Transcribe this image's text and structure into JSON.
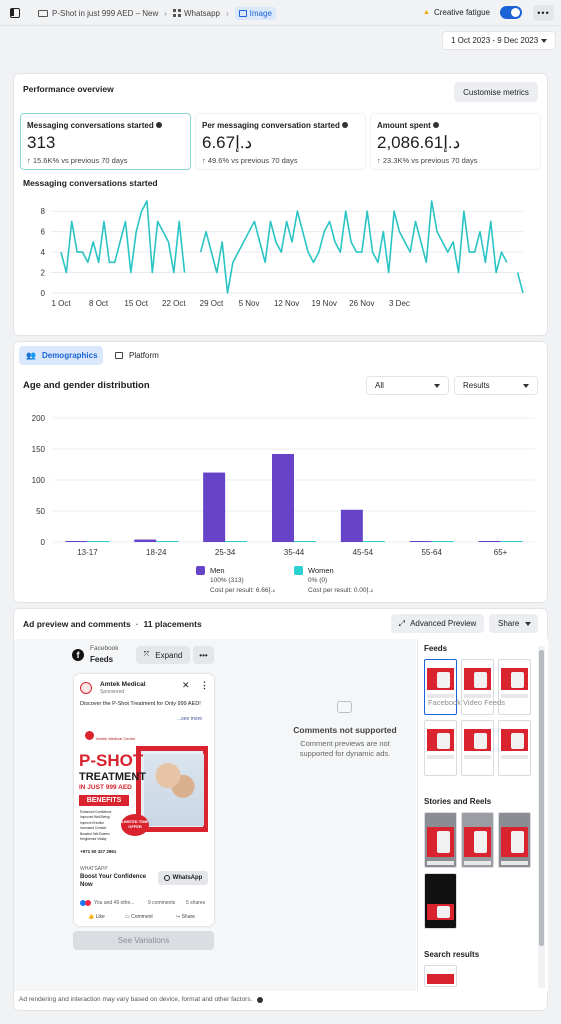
{
  "topbar": {
    "breadcrumbs": [
      "P-Shot in just 999 AED – New",
      "Whatsapp",
      "Image"
    ],
    "fatigue": "Creative fatigue",
    "date_range": "1 Oct 2023 - 9 Dec 2023"
  },
  "performance": {
    "title": "Performance overview",
    "customise": "Customise metrics",
    "metrics": [
      {
        "label": "Messaging conversations started",
        "value": "313",
        "change": "15.6K% vs previous 70 days"
      },
      {
        "label": "Per messaging conversation started",
        "value": "6.67د.إ",
        "change": "49.6% vs previous 70 days"
      },
      {
        "label": "Amount spent",
        "value": "2,086.61د.إ",
        "change": "23.3K% vs previous 70 days"
      }
    ],
    "chart_title": "Messaging conversations started"
  },
  "tabs": {
    "demographics": "Demographics",
    "platform": "Platform"
  },
  "age_gender": {
    "title": "Age and gender distribution",
    "filter_all": "All",
    "filter_results": "Results",
    "legend": [
      {
        "name": "Men",
        "pct": "100% (313)",
        "cost": "Cost per result: 6.66د.إ"
      },
      {
        "name": "Women",
        "pct": "0% (0)",
        "cost": "Cost per result: 0.00د.إ"
      }
    ]
  },
  "chart_data": [
    {
      "type": "line",
      "title": "Messaging conversations started",
      "x_ticks": [
        "1 Oct",
        "8 Oct",
        "15 Oct",
        "22 Oct",
        "29 Oct",
        "5 Nov",
        "12 Nov",
        "19 Nov",
        "26 Nov",
        "3 Dec"
      ],
      "y_ticks": [
        0,
        2,
        4,
        6,
        8
      ],
      "ylim": [
        0,
        9
      ],
      "series": [
        {
          "color": "#2bc4c4",
          "values": [
            4,
            2,
            7,
            4,
            4,
            3,
            5,
            3,
            7,
            3,
            3,
            5,
            7,
            2,
            6,
            8,
            9,
            2,
            7,
            6,
            5,
            2,
            7,
            2,
            null,
            null,
            4,
            6,
            4,
            2,
            5,
            0,
            3,
            4,
            5,
            6,
            7,
            5,
            3,
            7,
            5,
            4,
            7,
            5,
            8,
            6,
            4,
            3,
            4,
            6,
            7,
            5,
            4,
            8,
            5,
            4,
            4,
            8,
            4,
            3,
            6,
            2,
            8,
            6,
            5,
            4,
            7,
            5,
            3,
            9,
            6,
            5,
            4,
            5,
            2,
            8,
            4,
            4,
            6,
            3,
            7,
            2,
            4,
            3,
            null,
            2,
            0
          ]
        }
      ],
      "grid": true
    },
    {
      "type": "bar",
      "title": "Age and gender distribution",
      "categories": [
        "13-17",
        "18-24",
        "25-34",
        "35-44",
        "45-54",
        "55-64",
        "65+"
      ],
      "series": [
        {
          "name": "Men",
          "color": "#6743c8",
          "values": [
            1,
            4,
            112,
            142,
            52,
            1,
            1
          ]
        },
        {
          "name": "Women",
          "color": "#2ecfd0",
          "values": [
            0,
            0,
            0,
            0,
            0,
            0,
            0
          ]
        }
      ],
      "y_ticks": [
        0,
        50,
        100,
        150,
        200
      ],
      "ylim": [
        0,
        200
      ],
      "grid": true
    }
  ],
  "ad_preview": {
    "title": "Ad preview and comments",
    "placements": "11 placements",
    "advanced": "Advanced Preview",
    "share": "Share",
    "platform_name": "Facebook",
    "platform_sub": "Feeds",
    "expand": "Expand",
    "advertiser": "Amtek Medical",
    "sponsored": "Sponsored",
    "body_text": "Discover the P-Shot Treatment for Only 999 AED!",
    "see_more": "...see more",
    "creative": {
      "clinic": "Amtek Medical Centre",
      "headline1": "P-SHOT",
      "headline2": "TREATMENT",
      "headline3": "IN JUST 999 AED",
      "benefits": "BENEFITS",
      "list": [
        "Enhanced Confidence",
        "Improved Well-Being",
        "Improve Erection",
        "Increased Comfort",
        "Boosted Self-Esteem",
        "Heightened Vitality"
      ],
      "offer": "LIMITED TIME OFFER",
      "phone": "+971 50 327 2961"
    },
    "cta_site": "WHATSAPP",
    "cta_headline": "Boost Your Confidence Now",
    "cta_button": "WhatsApp",
    "reactions": "You and 49 othe...",
    "comments": "9 comments",
    "shares": "5 shares",
    "like": "Like",
    "comment": "Comment",
    "share_action": "Share",
    "see_variations": "See Variations",
    "no_comments_title": "Comments not supported",
    "no_comments_text": "Comment previews are not supported for dynamic ads.",
    "side_sections": [
      "Feeds",
      "Stories and Reels",
      "Search results"
    ],
    "side_overlay": "Facebook Video Feeds",
    "footer": "Ad rendering and interaction may vary based on device, format and other factors."
  }
}
